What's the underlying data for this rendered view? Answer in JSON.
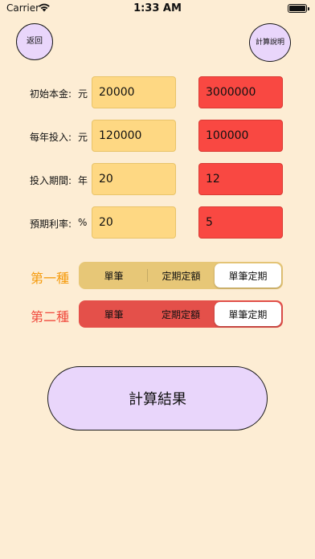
{
  "status": {
    "carrier": "Carrier",
    "time": "1:33 AM"
  },
  "nav": {
    "back_label": "返回",
    "help_label": "計算說明"
  },
  "rows": [
    {
      "label": "初始本金:",
      "unit": "元",
      "value_first": "20000",
      "value_second": "3000000"
    },
    {
      "label": "每年投入:",
      "unit": "元",
      "value_first": "120000",
      "value_second": "100000"
    },
    {
      "label": "投入期間:",
      "unit": "年",
      "value_first": "20",
      "value_second": "12"
    },
    {
      "label": "預期利率:",
      "unit": "%",
      "value_first": "20",
      "value_second": "5"
    }
  ],
  "segments": [
    {
      "label": "第一種",
      "options": [
        "單筆",
        "定期定額",
        "單筆定期"
      ],
      "selected": "單筆定期"
    },
    {
      "label": "第二種",
      "options": [
        "單筆",
        "定期定額",
        "單筆定期"
      ],
      "selected": "單筆定期"
    }
  ],
  "calculate_label": "計算結果",
  "colors": {
    "background": "#fdedd4",
    "first_accent": "#f59a0b",
    "second_accent": "#f04b3e",
    "first_field": "#fed883",
    "second_field": "#f94842",
    "button_purple": "#e9d6fb"
  }
}
